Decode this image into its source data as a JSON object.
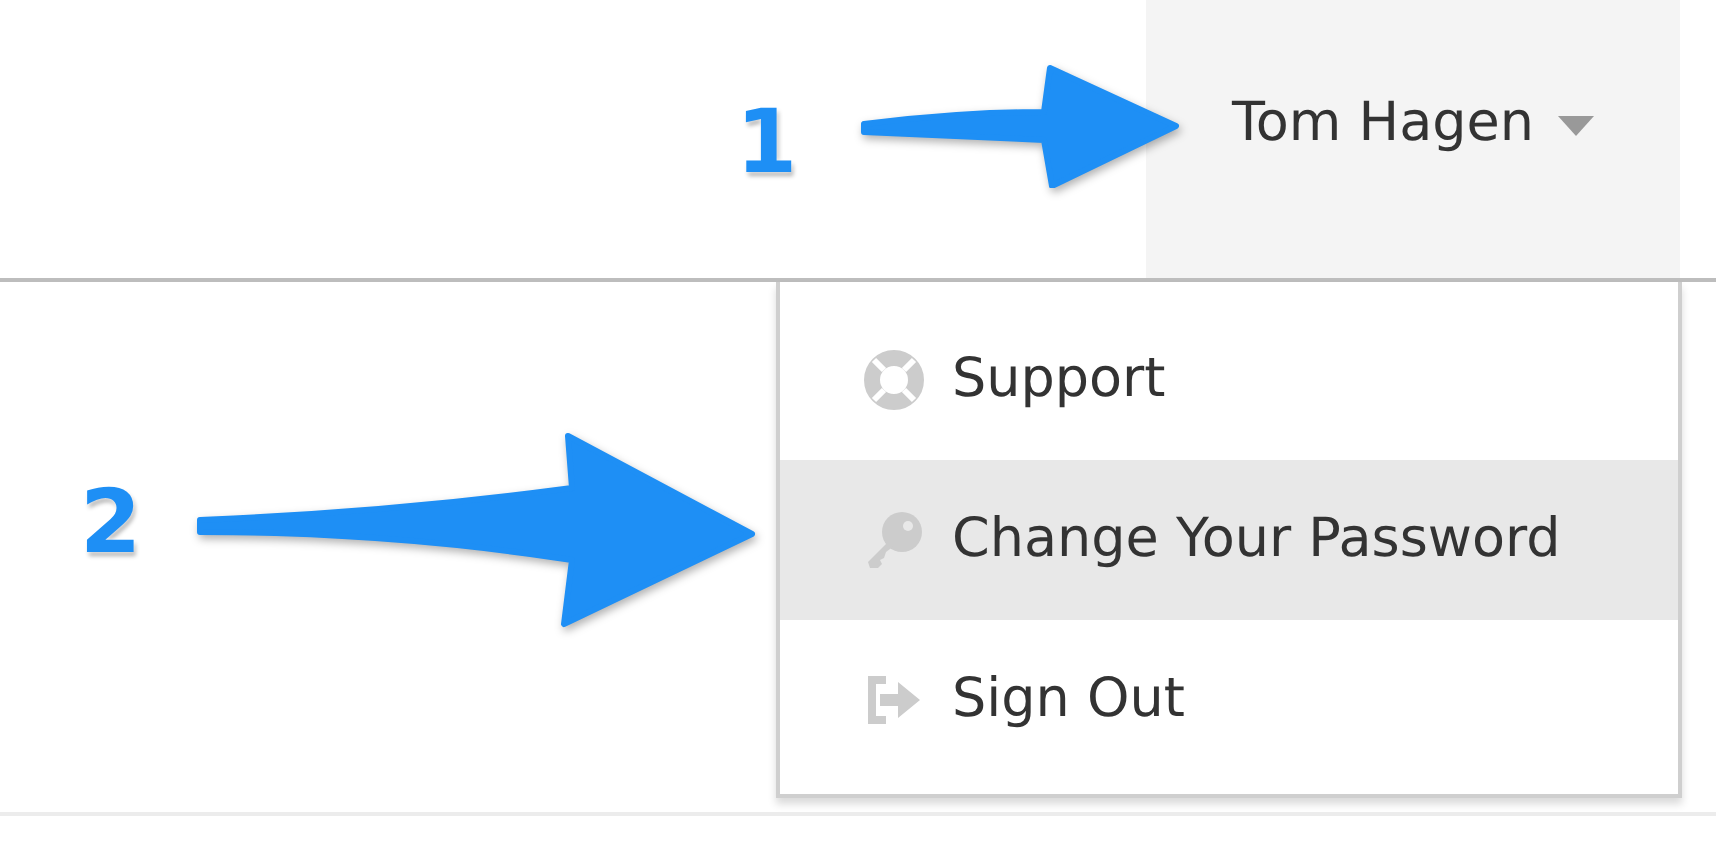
{
  "user_menu": {
    "name": "Tom Hagen",
    "expanded": true
  },
  "menu_items": [
    {
      "label": "Support",
      "kind": "support",
      "selected": false
    },
    {
      "label": "Change Your Password",
      "kind": "password",
      "selected": true
    },
    {
      "label": "Sign Out",
      "kind": "signout",
      "selected": false
    }
  ],
  "annotations": [
    {
      "label": "1"
    },
    {
      "label": "2"
    }
  ]
}
